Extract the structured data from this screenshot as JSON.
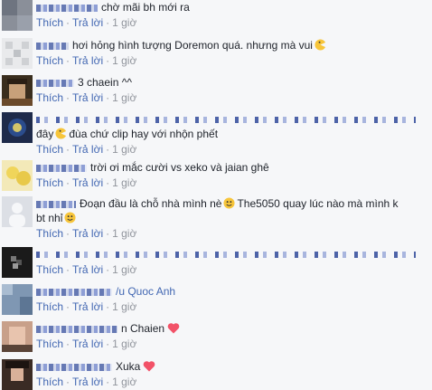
{
  "actions": {
    "like": "Thích",
    "reply": "Trả lời",
    "separator": "·",
    "time": "1 giờ"
  },
  "comments": [
    {
      "text": "chờ mãi bh mới ra"
    },
    {
      "text": "hơi hỏng hình tượng Doremon quá. nhưng mà vui"
    },
    {
      "text": "3 chaein ^^"
    },
    {
      "text": "đây",
      "text2": "đùa chứ clip hay với nhộn phết"
    },
    {
      "text": "trời ơi mắc cười vs xeko và jaian ghê"
    },
    {
      "text": "Đoạn đầu là chỗ nhà mình nè",
      "text2": "The5050 quay lúc nào mà mình k",
      "text3": "bt nhỉ"
    },
    {
      "text": ""
    },
    {
      "text": "/u Quoc Anh"
    },
    {
      "text": "n Chaien"
    },
    {
      "text": "Xuka"
    }
  ],
  "icons": {
    "smile": "smile-emoji-icon",
    "pacman": "pacman-emoji-icon",
    "heart": "heart-icon"
  },
  "colors": {
    "link": "#4267b2",
    "meta": "#90949c",
    "text": "#1d2129",
    "heart": "#f25268",
    "background": "#f6f7f9"
  }
}
